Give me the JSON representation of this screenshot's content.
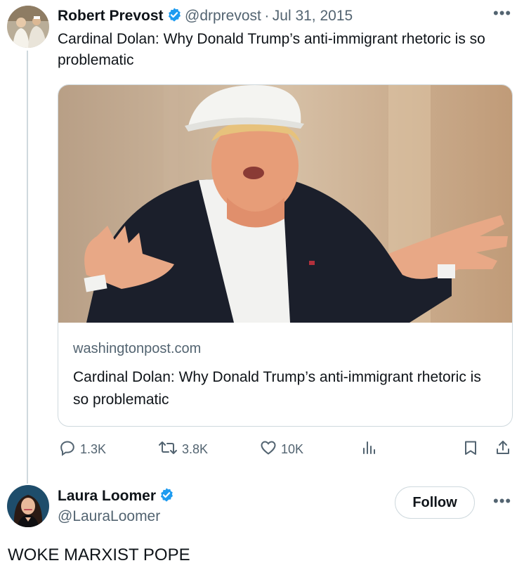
{
  "tweet": {
    "author_name": "Robert Prevost",
    "author_handle": "@drprevost",
    "date_sep": "·",
    "date": "Jul 31, 2015",
    "text": "Cardinal Dolan: Why Donald Trump’s anti-immigrant rhetoric is so problematic",
    "card": {
      "domain": "washingtonpost.com",
      "title": "Cardinal Dolan: Why Donald Trump’s anti-immigrant rhetoric is so problematic"
    },
    "actions": {
      "replies": "1.3K",
      "reposts": "3.8K",
      "likes": "10K"
    },
    "more_icon": "more-horizontal-icon"
  },
  "reply": {
    "author_name": "Laura Loomer",
    "author_handle": "@LauraLoomer",
    "follow_label": "Follow",
    "text": "WOKE MARXIST POPE"
  },
  "colors": {
    "verified": "#1d9bf0",
    "secondary_text": "#536471",
    "border": "#cfd9de"
  }
}
